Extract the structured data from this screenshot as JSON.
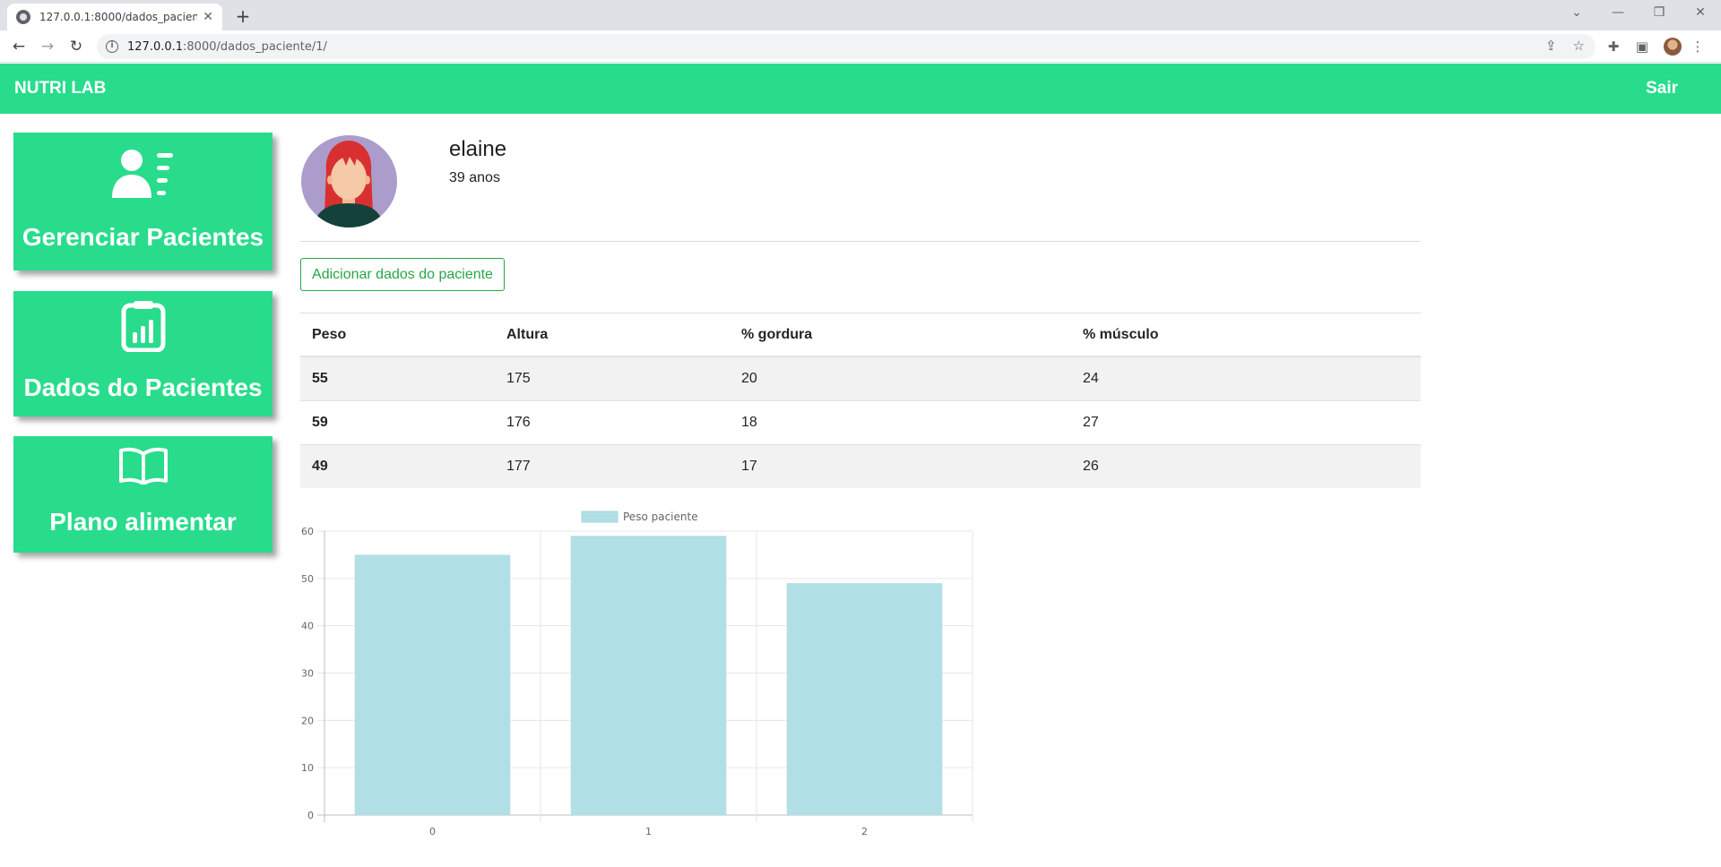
{
  "browser": {
    "tab_title": "127.0.0.1:8000/dados_paciente/1",
    "url_host": "127.0.0.1",
    "url_rest": ":8000/dados_paciente/1/",
    "new_tab": "+",
    "close_glyph": "✕"
  },
  "header": {
    "brand": "NUTRI LAB",
    "logout": "Sair",
    "color": "#28dc8c"
  },
  "sidebar": {
    "items": [
      {
        "label": "Gerenciar Pacientes",
        "icon": "patients-list-icon"
      },
      {
        "label": "Dados do Pacientes",
        "icon": "clipboard-chart-icon"
      },
      {
        "label": "Plano alimentar",
        "icon": "open-book-icon"
      }
    ]
  },
  "patient": {
    "name": "elaine",
    "age": "39 anos"
  },
  "actions": {
    "add_data": "Adicionar dados do paciente"
  },
  "table": {
    "headers": [
      "Peso",
      "Altura",
      "% gordura",
      "% músculo"
    ],
    "rows": [
      [
        "55",
        "175",
        "20",
        "24"
      ],
      [
        "59",
        "176",
        "18",
        "27"
      ],
      [
        "49",
        "177",
        "17",
        "26"
      ]
    ]
  },
  "chart_data": {
    "type": "bar",
    "categories": [
      "0",
      "1",
      "2"
    ],
    "series": [
      {
        "name": "Peso paciente",
        "values": [
          55,
          59,
          49
        ],
        "color": "#b0dfe5"
      }
    ],
    "ylim": [
      0,
      60
    ],
    "yticks": [
      0,
      10,
      20,
      30,
      40,
      50,
      60
    ],
    "legend": "top",
    "grid": true
  }
}
